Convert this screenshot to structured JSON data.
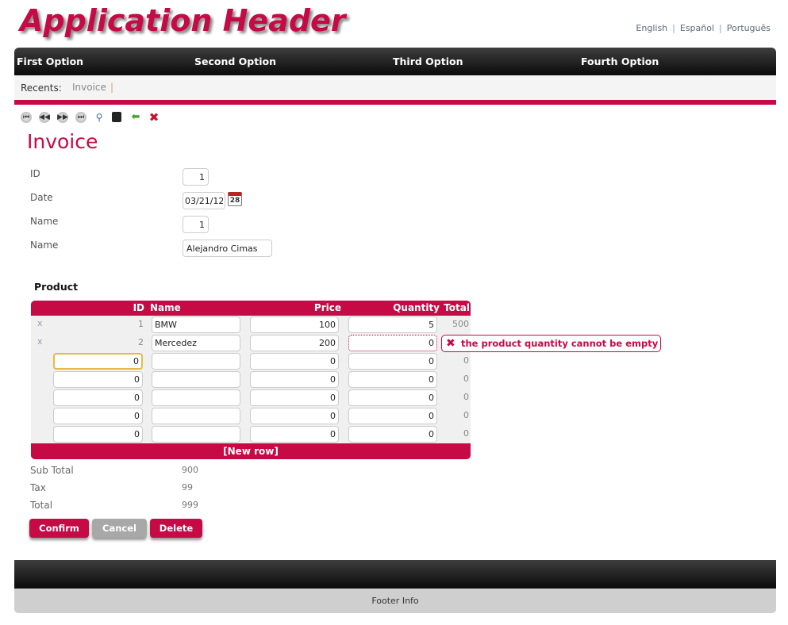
{
  "header": {
    "title": "Application Header",
    "languages": [
      "English",
      "Español",
      "Português"
    ]
  },
  "nav": {
    "items": [
      "First Option",
      "Second Option",
      "Third Option",
      "Fourth Option"
    ]
  },
  "recents": {
    "label": "Recents:",
    "items": [
      "Invoice"
    ]
  },
  "toolbar": {
    "icons": [
      "first-icon",
      "previous-icon",
      "next-icon",
      "last-icon",
      "search-icon",
      "save-icon",
      "back-icon",
      "delete-icon"
    ]
  },
  "form": {
    "title": "Invoice",
    "fields": [
      {
        "label": "ID",
        "value": "1"
      },
      {
        "label": "Date",
        "value": "03/21/12"
      },
      {
        "label": "Name",
        "value": "1"
      },
      {
        "label": "Name",
        "value": "Alejandro Cimas"
      }
    ],
    "calendar_day": "28"
  },
  "product": {
    "label": "Product",
    "columns": [
      "ID",
      "Name",
      "Price",
      "Quantity",
      "Total"
    ],
    "rows": [
      {
        "id": "1",
        "name": "BMW",
        "price": "100",
        "quantity": "5",
        "total": "500"
      },
      {
        "id": "2",
        "name": "Mercedez",
        "price": "200",
        "quantity": "0",
        "total": ""
      },
      {
        "id": "0",
        "name": "",
        "price": "0",
        "quantity": "0",
        "total": "0"
      },
      {
        "id": "0",
        "name": "",
        "price": "0",
        "quantity": "0",
        "total": "0"
      },
      {
        "id": "0",
        "name": "",
        "price": "0",
        "quantity": "0",
        "total": "0"
      },
      {
        "id": "0",
        "name": "",
        "price": "0",
        "quantity": "0",
        "total": "0"
      },
      {
        "id": "0",
        "name": "",
        "price": "0",
        "quantity": "0",
        "total": "0"
      }
    ],
    "remove_glyph": "x",
    "new_row": "[New row]",
    "error": "the product quantity cannot be empty"
  },
  "summary": [
    {
      "label": "Sub Total",
      "value": "900"
    },
    {
      "label": "Tax",
      "value": "99"
    },
    {
      "label": "Total",
      "value": "999"
    }
  ],
  "buttons": {
    "confirm": "Confirm",
    "cancel": "Cancel",
    "delete": "Delete"
  },
  "footer": {
    "info": "Footer Info"
  },
  "colors": {
    "accent": "#c50a45",
    "nav": "#1a1a1a",
    "cancel": "#a8a8a8"
  }
}
